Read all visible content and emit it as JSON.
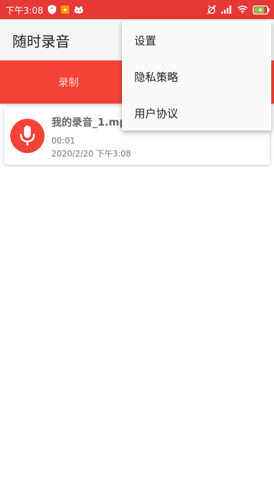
{
  "status_bar": {
    "time": "下午3:08",
    "battery_level_fraction": 0.8,
    "icons": [
      "shield-icon",
      "app-notification-icon",
      "weibo-icon",
      "alarm-off-icon",
      "signal-icon",
      "wifi-icon",
      "battery-charging-icon"
    ]
  },
  "app_bar": {
    "title": "随时录音"
  },
  "tabs": [
    {
      "label": "录制"
    }
  ],
  "recordings": [
    {
      "name": "我的录音_1.mp3",
      "duration": "00:01",
      "date": "2020/2/20 下午3:08",
      "icon": "microphone-icon"
    }
  ],
  "overflow_menu": {
    "items": [
      {
        "label": "设置"
      },
      {
        "label": "隐私策略"
      },
      {
        "label": "用户协议"
      }
    ]
  },
  "colors": {
    "status_bar": "#e53935",
    "primary": "#f44336",
    "tab_text": "#ffd7d3",
    "battery_charge": "#8bc34a"
  }
}
